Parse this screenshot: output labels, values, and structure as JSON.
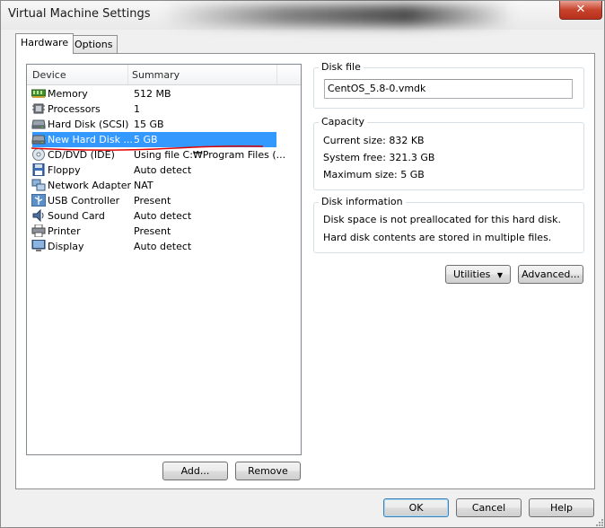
{
  "window": {
    "title": "Virtual Machine Settings",
    "close_label": "✕"
  },
  "tabs": [
    {
      "label": "Hardware",
      "active": true
    },
    {
      "label": "Options",
      "active": false
    }
  ],
  "device_list": {
    "columns": [
      "Device",
      "Summary"
    ],
    "rows": [
      {
        "device": "Memory",
        "summary": "512 MB",
        "icon": "memory-icon"
      },
      {
        "device": "Processors",
        "summary": "1",
        "icon": "processor-icon"
      },
      {
        "device": "Hard Disk (SCSI)",
        "summary": "15 GB",
        "icon": "hard-disk-icon"
      },
      {
        "device": "New Hard Disk ...",
        "summary": "5 GB",
        "icon": "hard-disk-icon",
        "selected": true
      },
      {
        "device": "CD/DVD (IDE)",
        "summary": "Using file C:₩Program Files (...",
        "icon": "cd-dvd-icon"
      },
      {
        "device": "Floppy",
        "summary": "Auto detect",
        "icon": "floppy-icon"
      },
      {
        "device": "Network Adapter",
        "summary": "NAT",
        "icon": "network-adapter-icon"
      },
      {
        "device": "USB Controller",
        "summary": "Present",
        "icon": "usb-icon"
      },
      {
        "device": "Sound Card",
        "summary": "Auto detect",
        "icon": "sound-card-icon"
      },
      {
        "device": "Printer",
        "summary": "Present",
        "icon": "printer-icon"
      },
      {
        "device": "Display",
        "summary": "Auto detect",
        "icon": "display-icon"
      }
    ]
  },
  "disk_file": {
    "title": "Disk file",
    "value": "CentOS_5.8-0.vmdk"
  },
  "capacity": {
    "title": "Capacity",
    "current": "Current size: 832 KB",
    "free": "System free: 321.3 GB",
    "max": "Maximum size: 5 GB"
  },
  "disk_info": {
    "title": "Disk information",
    "line1": "Disk space is not preallocated for this hard disk.",
    "line2": "Hard disk contents are stored in multiple files."
  },
  "buttons": {
    "utilities": "Utilities",
    "advanced": "Advanced...",
    "add": "Add...",
    "remove": "Remove",
    "ok": "OK",
    "cancel": "Cancel",
    "help": "Help"
  },
  "colors": {
    "selection": "#3399ff",
    "annotation": "#e00000"
  }
}
